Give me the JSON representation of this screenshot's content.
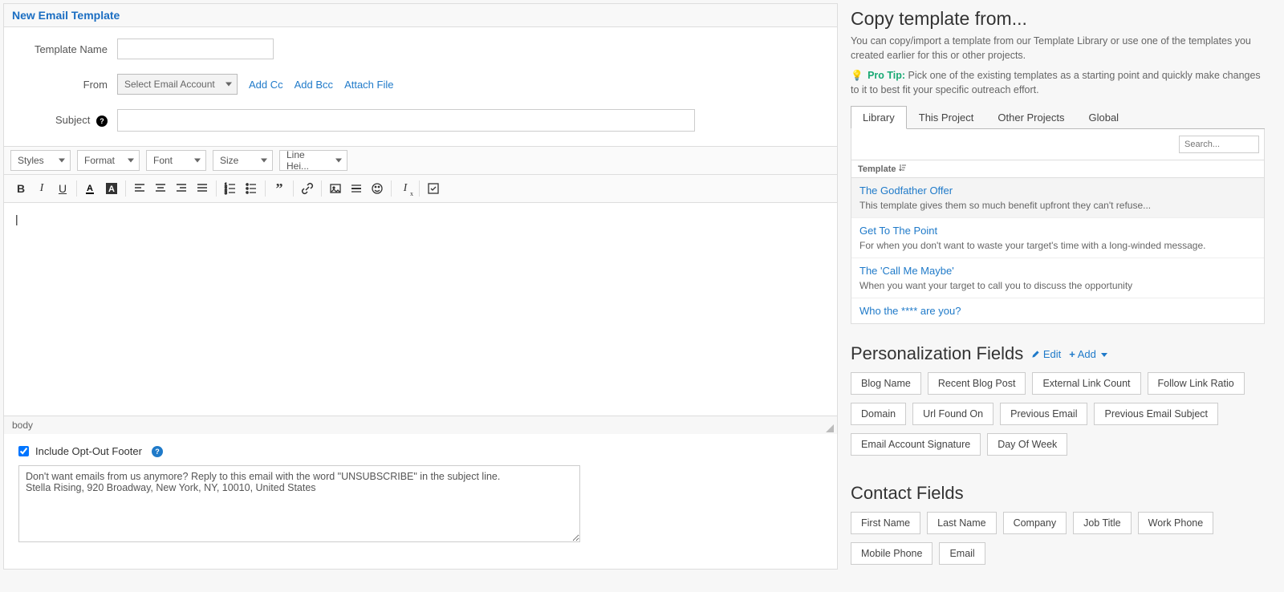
{
  "panel": {
    "title": "New Email Template",
    "labels": {
      "template_name": "Template Name",
      "from": "From",
      "subject": "Subject"
    },
    "from_select": "Select Email Account",
    "links": {
      "add_cc": "Add Cc",
      "add_bcc": "Add Bcc",
      "attach_file": "Attach File"
    },
    "toolbar_dropdowns": [
      "Styles",
      "Format",
      "Font",
      "Size",
      "Line Hei..."
    ],
    "editor_path": "body",
    "editor_initial": "|",
    "footer": {
      "checkbox_label": "Include Opt-Out Footer",
      "text": "Don't want emails from us anymore? Reply to this email with the word \"UNSUBSCRIBE\" in the subject line.\nStella Rising, 920 Broadway, New York, NY, 10010, United States"
    }
  },
  "copy": {
    "title": "Copy template from...",
    "desc": "You can copy/import a template from our Template Library or use one of the templates you created earlier for this or other projects.",
    "protip_label": "Pro Tip:",
    "protip_text": " Pick one of the existing templates as a starting point and quickly make changes to it to best fit your specific outreach effort.",
    "tabs": [
      "Library",
      "This Project",
      "Other Projects",
      "Global"
    ],
    "search_placeholder": "Search...",
    "column_header": "Template",
    "templates": [
      {
        "name": "The Godfather Offer",
        "desc": "This template gives them so much benefit upfront they can't refuse..."
      },
      {
        "name": "Get To The Point",
        "desc": "For when you don't want to waste your target's time with a long-winded message."
      },
      {
        "name": "The 'Call Me Maybe'",
        "desc": "When you want your target to call you to discuss the opportunity"
      },
      {
        "name": "Who the **** are you?",
        "desc": ""
      }
    ]
  },
  "personalization": {
    "title": "Personalization Fields",
    "edit": "Edit",
    "add": "Add",
    "fields": [
      "Blog Name",
      "Recent Blog Post",
      "External Link Count",
      "Follow Link Ratio",
      "Domain",
      "Url Found On",
      "Previous Email",
      "Previous Email Subject",
      "Email Account Signature",
      "Day Of Week"
    ]
  },
  "contact": {
    "title": "Contact Fields",
    "fields": [
      "First Name",
      "Last Name",
      "Company",
      "Job Title",
      "Work Phone",
      "Mobile Phone",
      "Email"
    ]
  }
}
